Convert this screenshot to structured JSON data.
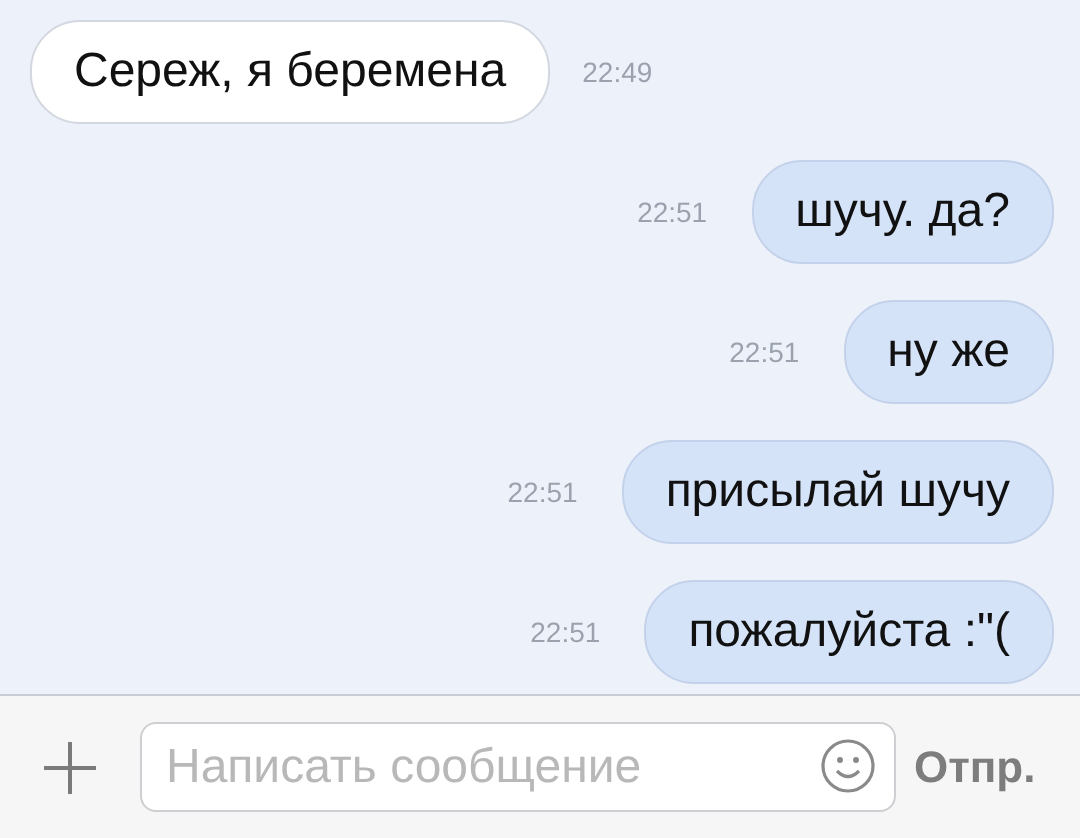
{
  "messages": [
    {
      "kind": "incoming",
      "text": "Сереж, я беремена",
      "time": "22:49"
    },
    {
      "kind": "outgoing",
      "text": "шучу. да?",
      "time": "22:51"
    },
    {
      "kind": "outgoing",
      "text": "ну же",
      "time": "22:51"
    },
    {
      "kind": "outgoing",
      "text": "присылай шучу",
      "time": "22:51"
    },
    {
      "kind": "outgoing",
      "text": "пожалуйста :\"(",
      "time": "22:51"
    }
  ],
  "composer": {
    "placeholder": "Написать сообщение",
    "send": "Отпр."
  }
}
